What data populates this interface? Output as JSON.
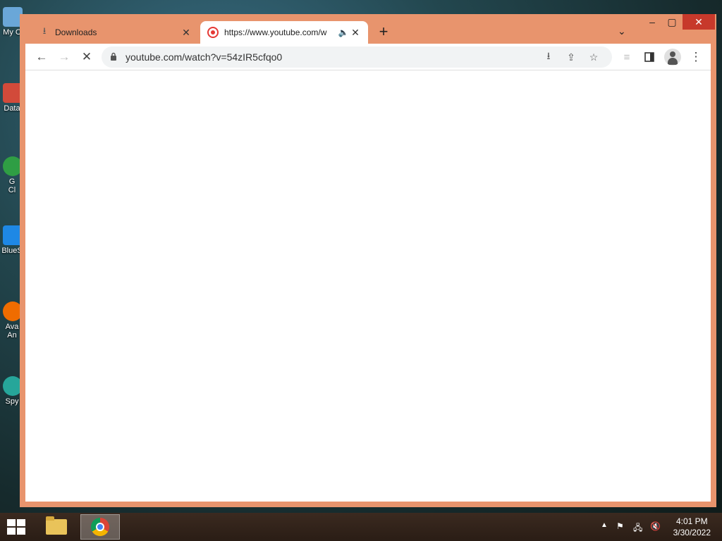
{
  "desktop": {
    "icons": [
      {
        "label": "My C",
        "color": "#6aa7d8"
      },
      {
        "label": "Data",
        "color": "#d24a3a"
      },
      {
        "label": "G",
        "label2": "Cl",
        "color": "#2f9e44"
      },
      {
        "label": "BlueS",
        "color": "#1e88e5"
      },
      {
        "label": "Ava",
        "label2": "An",
        "color": "#ef6c00"
      },
      {
        "label": "Spy",
        "color": "#26a69a"
      }
    ]
  },
  "browser": {
    "tabs": [
      {
        "label": "Downloads",
        "icon": "download-icon"
      },
      {
        "label": "https://www.youtube.com/w",
        "icon": "youtube-icon",
        "audio": "speaker-icon"
      }
    ],
    "new_tab": "+",
    "url": "youtube.com/watch?v=54zIR5cfqo0",
    "colors": {
      "frame": "#e8946d",
      "close_button": "#c7392b"
    }
  },
  "taskbar": {
    "time": "4:01 PM",
    "date": "3/30/2022"
  }
}
